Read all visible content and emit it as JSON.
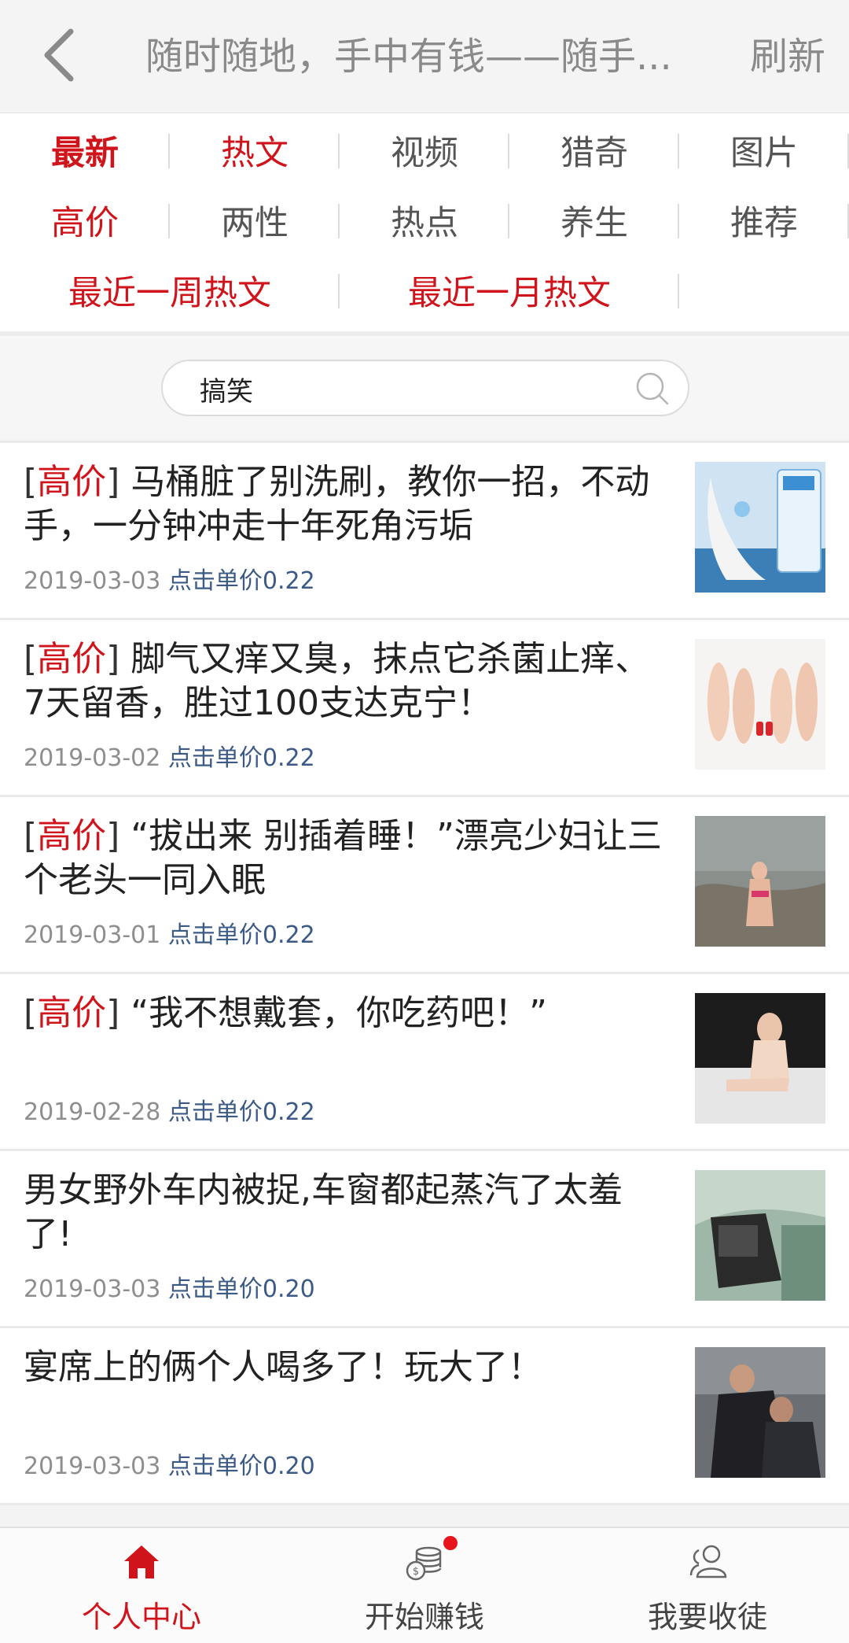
{
  "header": {
    "title": "随时随地，手中有钱——随手...",
    "refresh_label": "刷新"
  },
  "categories": {
    "row1": [
      "最新",
      "热文",
      "视频",
      "猎奇",
      "图片"
    ],
    "row2": [
      "高价",
      "两性",
      "热点",
      "养生",
      "推荐"
    ],
    "row3": [
      "最近一周热文",
      "最近一月热文"
    ]
  },
  "search": {
    "value": "搞笑"
  },
  "articles": [
    {
      "bracket_open": "[",
      "tag": "高价",
      "bracket_close": "]",
      "title": " 马桶脏了别洗刷，教你一招，不动手，一分钟冲走十年死角污垢",
      "date": "2019-03-03",
      "price_label": "点击单价0.22"
    },
    {
      "bracket_open": "[",
      "tag": "高价",
      "bracket_close": "]",
      "title": " 脚气又痒又臭，抹点它杀菌止痒、7天留香，胜过100支达克宁！",
      "date": "2019-03-02",
      "price_label": "点击单价0.22"
    },
    {
      "bracket_open": "[",
      "tag": "高价",
      "bracket_close": "]",
      "title": " “拔出来 别插着睡！”漂亮少妇让三个老头一同入眠",
      "date": "2019-03-01",
      "price_label": "点击单价0.22"
    },
    {
      "bracket_open": "[",
      "tag": "高价",
      "bracket_close": "]",
      "title": " “我不想戴套，你吃药吧！”",
      "date": "2019-02-28",
      "price_label": "点击单价0.22"
    },
    {
      "bracket_open": "",
      "tag": "",
      "bracket_close": "",
      "title": "男女野外车内被捉,车窗都起蒸汽了太羞了!",
      "date": "2019-03-03",
      "price_label": "点击单价0.20"
    },
    {
      "bracket_open": "",
      "tag": "",
      "bracket_close": "",
      "title": "宴席上的俩个人喝多了！玩大了！",
      "date": "2019-03-03",
      "price_label": "点击单价0.20"
    }
  ],
  "tabbar": {
    "items": [
      {
        "label": "个人中心",
        "icon": "home-icon"
      },
      {
        "label": "开始赚钱",
        "icon": "coins-icon"
      },
      {
        "label": "我要收徒",
        "icon": "users-icon"
      }
    ]
  },
  "colors": {
    "accent_red": "#d0141b",
    "meta_gray": "#8e8e8e",
    "price_blue": "#3b5a86"
  }
}
